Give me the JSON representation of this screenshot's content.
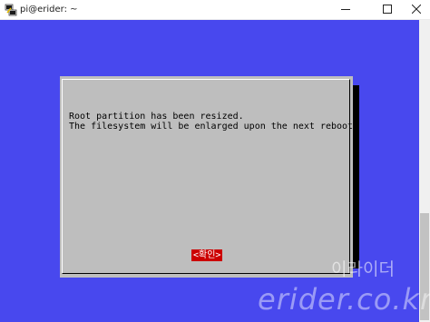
{
  "window": {
    "title": "pi@erider: ~",
    "app_icon": "putty-icon",
    "controls": [
      "minimize-icon",
      "maximize-icon",
      "close-icon"
    ]
  },
  "terminal": {
    "background_color": "#4848ee"
  },
  "dialog": {
    "lines": [
      "Root partition has been resized.",
      "The filesystem will be enlarged upon the next reboot"
    ],
    "ok_button": "<확인>",
    "ok_button_color": "#cc0000"
  },
  "watermark": {
    "korean": "이라이더",
    "domain": "erider.co.kr"
  }
}
